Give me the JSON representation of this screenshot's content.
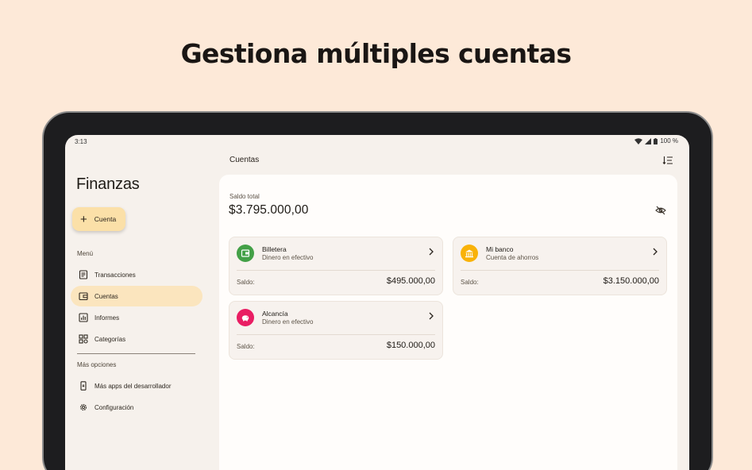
{
  "headline": "Gestiona múltiples cuentas",
  "status": {
    "time": "3:13",
    "battery": "100 %"
  },
  "sidebar": {
    "app_title": "Finanzas",
    "fab_label": "Cuenta",
    "menu_label": "Menú",
    "menu_items": [
      {
        "label": "Transacciones",
        "icon": "receipt-icon"
      },
      {
        "label": "Cuentas",
        "icon": "wallet-icon",
        "active": true
      },
      {
        "label": "Informes",
        "icon": "chart-icon"
      },
      {
        "label": "Categorías",
        "icon": "category-icon"
      }
    ],
    "more_label": "Más opciones",
    "more_items": [
      {
        "label": "Más apps del desarrollador",
        "icon": "phone-icon"
      },
      {
        "label": "Configuración",
        "icon": "gear-icon"
      }
    ]
  },
  "main": {
    "title": "Cuentas",
    "total_label": "Saldo total",
    "total_value": "$3.795.000,00",
    "accounts": [
      {
        "name": "Billetera",
        "type": "Dinero en efectivo",
        "saldo_label": "Saldo:",
        "saldo": "$495.000,00",
        "color": "#43a047",
        "icon": "wallet-icon"
      },
      {
        "name": "Mi banco",
        "type": "Cuenta de ahorros",
        "saldo_label": "Saldo:",
        "saldo": "$3.150.000,00",
        "color": "#f9b208",
        "icon": "bank-icon"
      },
      {
        "name": "Alcancía",
        "type": "Dinero en efectivo",
        "saldo_label": "Saldo:",
        "saldo": "$150.000,00",
        "color": "#e91e63",
        "icon": "piggy-bank-icon"
      }
    ]
  }
}
